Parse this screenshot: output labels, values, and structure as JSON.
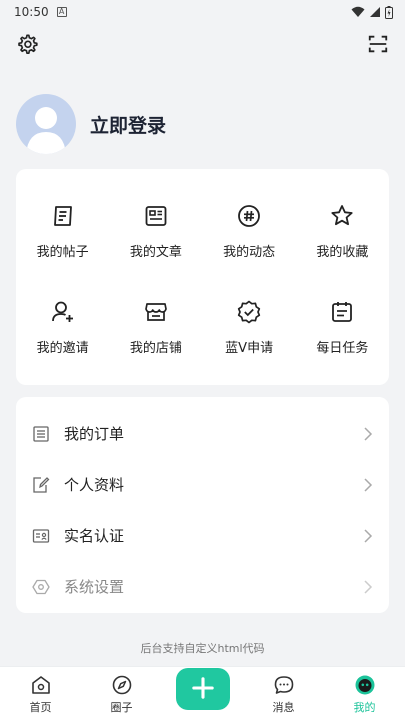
{
  "status": {
    "time": "10:50",
    "notif": "A"
  },
  "profile": {
    "login_label": "立即登录"
  },
  "grid": {
    "row1": [
      {
        "label": "我的帖子"
      },
      {
        "label": "我的文章"
      },
      {
        "label": "我的动态"
      },
      {
        "label": "我的收藏"
      }
    ],
    "row2": [
      {
        "label": "我的邀请"
      },
      {
        "label": "我的店铺"
      },
      {
        "label": "蓝V申请"
      },
      {
        "label": "每日任务"
      }
    ]
  },
  "list": [
    {
      "label": "我的订单"
    },
    {
      "label": "个人资料"
    },
    {
      "label": "实名认证"
    },
    {
      "label": "系统设置"
    }
  ],
  "footer_note": "后台支持自定义html代码",
  "tabs": [
    {
      "label": "首页"
    },
    {
      "label": "圈子"
    },
    {
      "label": "消息"
    },
    {
      "label": "我的"
    }
  ],
  "colors": {
    "accent": "#20c8a0",
    "avatar_bg": "#c4d3ee"
  }
}
